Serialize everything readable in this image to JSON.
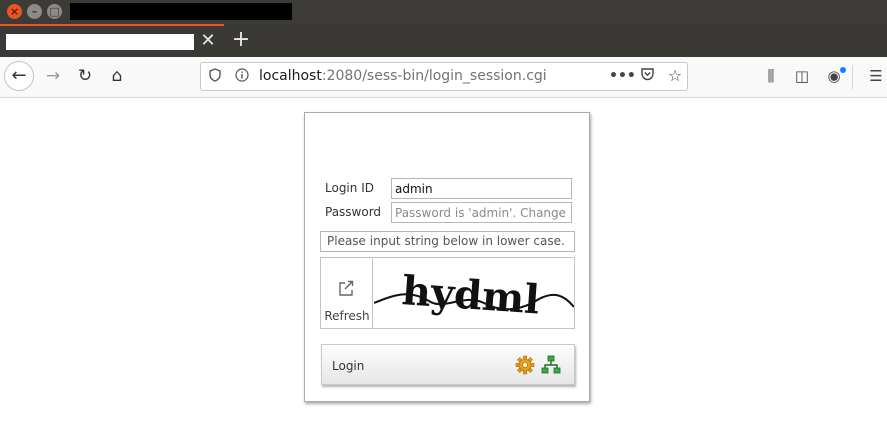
{
  "window": {
    "close_label": "×",
    "min_label": "–",
    "max_label": "□"
  },
  "tab": {
    "close_glyph": "✕",
    "new_tab_glyph": "+"
  },
  "nav": {
    "back_glyph": "←",
    "forward_glyph": "→",
    "reload_glyph": "↻",
    "home_glyph": "⌂",
    "url_host": "localhost",
    "url_rest": ":2080/sess-bin/login_session.cgi",
    "more_glyph": "•••",
    "star_glyph": "☆",
    "library_glyph": "⫼",
    "sidebar_glyph": "◫",
    "account_glyph": "◉",
    "menu_glyph": "☰"
  },
  "login": {
    "id_label": "Login ID",
    "id_value": "admin",
    "password_label": "Password",
    "password_placeholder": "Password is 'admin'. Change the",
    "captcha_hint": "Please input string below in lower case.",
    "captcha_text": "hydml",
    "refresh_label": "Refresh",
    "login_button_label": "Login"
  },
  "colors": {
    "accent": "#e95420",
    "titlebar": "#3c3b37",
    "notification_dot": "#0a84ff"
  }
}
